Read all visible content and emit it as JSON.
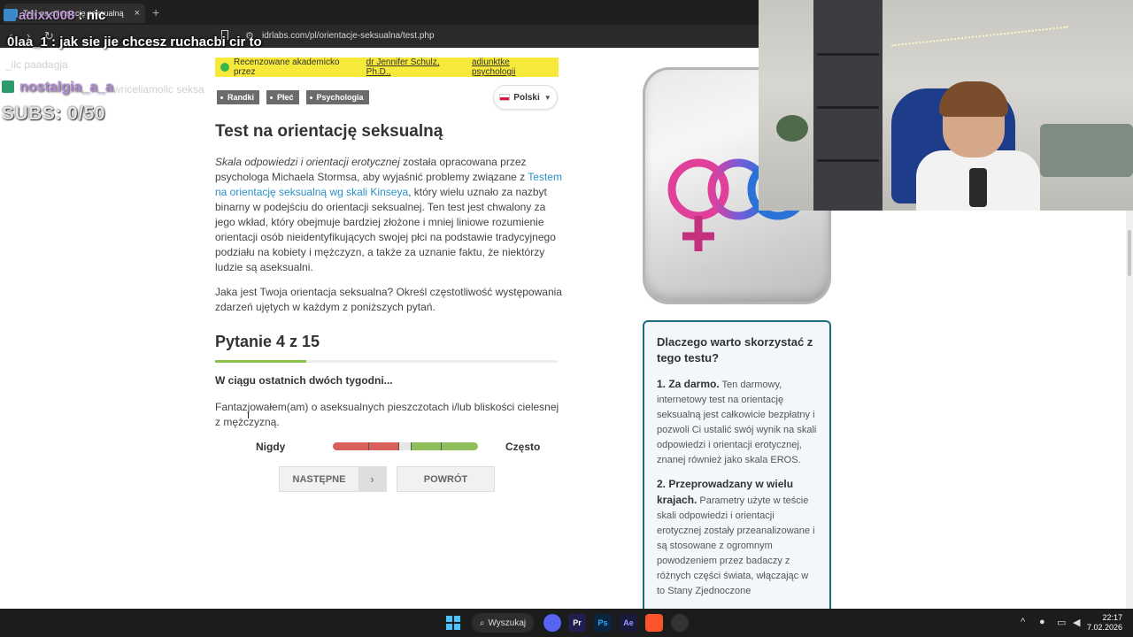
{
  "browser": {
    "tab_title": "Test na orientację seksualną",
    "tab_close": "×",
    "new_tab": "+",
    "url": "idrlabs.com/pl/orientacje-seksualna/test.php"
  },
  "overlay": {
    "chat1_user": "adixx008",
    "chat1_text": " : nic",
    "chat2_user": "0laa_1",
    "chat2_text": " : jak sie jie chcesz ruchacbi cir to",
    "chat_ghost": "_ilc paadagja",
    "chat3_user": "nostalgia_a_a",
    "chat3_ghost": "wriceliamolic seksa",
    "subs": "SUBS: 0/50"
  },
  "page": {
    "review_prefix": "Recenzowane akademicko przez",
    "review_author": "dr Jennifer Schulz, Ph.D.,",
    "review_role": "adiunktke psychologii",
    "tags": [
      "Randki",
      "Płeć",
      "Psychologia"
    ],
    "language": "Polski",
    "title": "Test na orientację seksualną",
    "intro_em": "Skala odpowiedzi i orientacji erotycznej",
    "intro_part1": " została opracowana przez psychologa Michaela Stormsa, aby wyjaśnić problemy związane z ",
    "intro_link": "Testem na orientację seksualną wg skali Kinseya",
    "intro_part2": ", który wielu uznało za nazbyt binarny w podejściu do orientacji seksualnej. Ten test jest chwalony za jego wkład, który obejmuje bardziej złożone i mniej liniowe rozumienie orientacji osób nieidentyfikujących swojej płci na podstawie tradycyjnego podziału na kobiety i mężczyzn, a także za uznanie faktu, że niektórzy ludzie są aseksualni.",
    "prompt": "Jaka jest Twoja orientacja seksualna? Określ częstotliwość występowania zdarzeń ujętych w każdym z poniższych pytań.",
    "question_title": "Pytanie 4 z 15",
    "question_progress": 0.267,
    "subhead": "W ciągu ostatnich dwóch tygodni...",
    "statement": "Fantazjowałem(am) o aseksualnych pieszczotach i/lub bliskości cielesnej z mężczyzną.",
    "scale_left": "Nigdy",
    "scale_right": "Często",
    "next_label": "NASTĘPNE",
    "next_arrow": "›",
    "back_label": "POWRÓT"
  },
  "sidebar": {
    "why_title": "Dlaczego warto skorzystać z tego testu?",
    "point1_title": "1. Za darmo.",
    "point1_text": " Ten darmowy, internetowy test na orientację seksualną jest całkowicie bezpłatny i pozwoli Ci ustalić swój wynik na skali odpowiedzi i orientacji erotycznej, znanej również jako skala EROS.",
    "point2_title": "2. Przeprowadzany w wielu krajach.",
    "point2_text": " Parametry użyte w teście skali odpowiedzi i orientacji erotycznej zostały przeanalizowane i są stosowane z ogromnym powodzeniem przez badaczy z różnych części świata, włączając w to Stany Zjednoczone"
  },
  "taskbar": {
    "search_label": "Wyszukaj",
    "apps": [
      "Pr",
      "Ps",
      "Ae"
    ],
    "time": "22:17",
    "date": "7.02.2026"
  },
  "colors": {
    "review_bg": "#f7e93a",
    "link": "#2a8fc7",
    "progress": "#8bc34a",
    "scale_red": "#d9605a",
    "scale_green": "#8fbf5a",
    "why_border": "#1f6a7d"
  }
}
